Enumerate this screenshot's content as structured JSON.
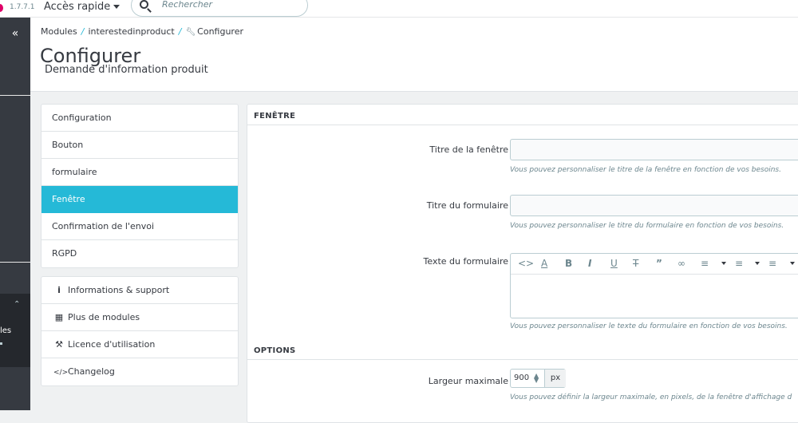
{
  "topbar": {
    "version": "1.7.7.1",
    "quick_access": "Accès rapide",
    "search_placeholder": "Rechercher"
  },
  "sidebar": {
    "collapse_glyph": "«",
    "partial_label": "les"
  },
  "breadcrumb": {
    "items": [
      "Modules",
      "interestedinproduct",
      "Configurer"
    ],
    "separator": "/"
  },
  "header": {
    "title": "Configurer",
    "subtitle": "Demande d'information produit"
  },
  "menu": {
    "items": [
      {
        "label": "Configuration",
        "active": false
      },
      {
        "label": "Bouton",
        "active": false
      },
      {
        "label": "formulaire",
        "active": false
      },
      {
        "label": "Fenêtre",
        "active": true
      },
      {
        "label": "Confirmation de l'envoi",
        "active": false
      },
      {
        "label": "RGPD",
        "active": false
      }
    ]
  },
  "support_menu": {
    "items": [
      {
        "label": "Informations & support",
        "icon": "info-icon"
      },
      {
        "label": "Plus de modules",
        "icon": "modules-icon"
      },
      {
        "label": "Licence d'utilisation",
        "icon": "gavel-icon"
      },
      {
        "label": "Changelog",
        "icon": "code-icon"
      }
    ]
  },
  "form": {
    "section1_title": "FENÊTRE",
    "window_title_label": "Titre de la fenêtre",
    "window_title_value": "",
    "window_title_help": "Vous pouvez personnaliser le titre de la fenêtre en fonction de vos besoins.",
    "form_title_label": "Titre du formulaire",
    "form_title_value": "",
    "form_title_help": "Vous pouvez personnaliser le titre du formulaire en fonction de vos besoins.",
    "form_text_label": "Texte du formulaire",
    "form_text_help": "Vous pouvez personnaliser le texte du formulaire en fonction de vos besoins.",
    "section2_title": "OPTIONS",
    "max_width_label": "Largeur maximale",
    "max_width_value": "900",
    "max_width_unit": "px",
    "max_width_help": "Vous pouvez définir la largeur maximale, en pixels, de la fenêtre d'affichage d"
  },
  "colors": {
    "accent": "#25b9d7",
    "sidebar": "#363a41",
    "brand": "#df0067"
  }
}
